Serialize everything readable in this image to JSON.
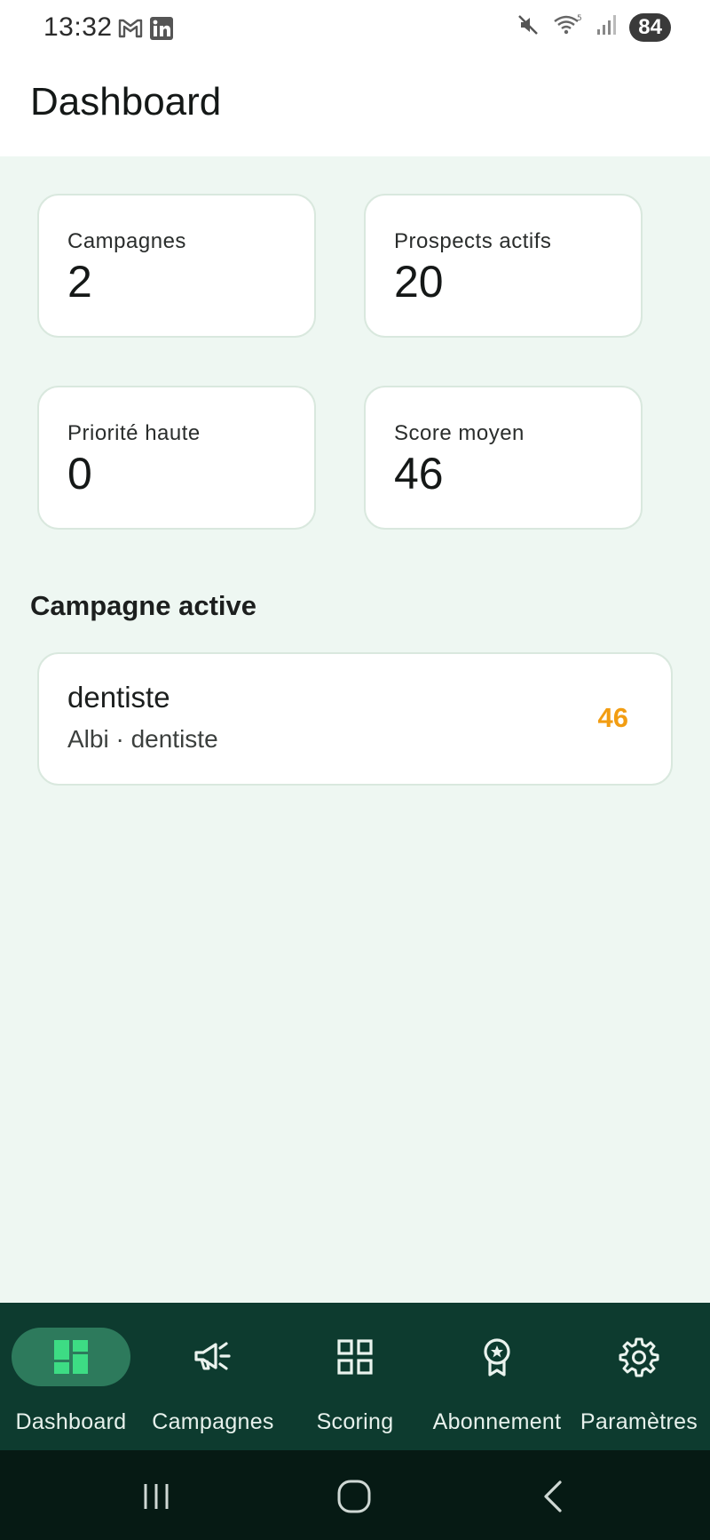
{
  "status_bar": {
    "time": "13:32",
    "battery": "84",
    "left_icons": [
      "gmail-icon",
      "linkedin-icon"
    ],
    "right_icons": [
      "mute-icon",
      "wifi-icon",
      "signal-icon"
    ]
  },
  "app_bar": {
    "title": "Dashboard"
  },
  "stats": [
    {
      "label": "Campagnes",
      "value": "2"
    },
    {
      "label": "Prospects actifs",
      "value": "20"
    },
    {
      "label": "Priorité haute",
      "value": "0"
    },
    {
      "label": "Score moyen",
      "value": "46"
    }
  ],
  "active_campaign": {
    "section_title": "Campagne active",
    "name": "dentiste",
    "subtitle": "Albi · dentiste",
    "score": "46"
  },
  "bottom_nav": {
    "items": [
      {
        "label": "Dashboard",
        "icon": "dashboard-icon",
        "selected": true
      },
      {
        "label": "Campagnes",
        "icon": "megaphone-icon",
        "selected": false
      },
      {
        "label": "Scoring",
        "icon": "grid-icon",
        "selected": false
      },
      {
        "label": "Abonnement",
        "icon": "award-icon",
        "selected": false
      },
      {
        "label": "Paramètres",
        "icon": "gear-icon",
        "selected": false
      }
    ]
  },
  "colors": {
    "background": "#eef7f2",
    "nav_background": "#0d3b2f",
    "nav_selected_pill": "#2d7a5c",
    "accent_green": "#3ddc84",
    "score_orange": "#f29d12"
  }
}
